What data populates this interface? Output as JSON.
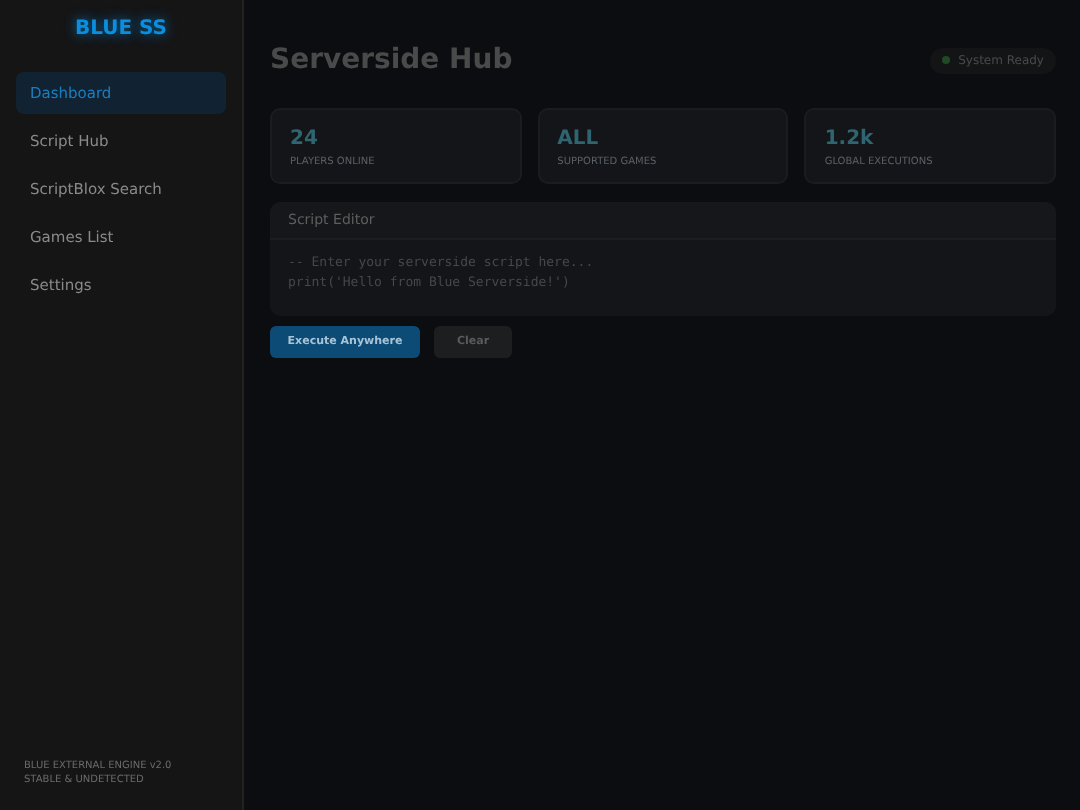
{
  "sidebar": {
    "logo": "BLUE SS",
    "items": [
      {
        "label": "Dashboard",
        "selected": true
      },
      {
        "label": "Script Hub",
        "selected": false
      },
      {
        "label": "ScriptBlox Search",
        "selected": false
      },
      {
        "label": "Games List",
        "selected": false
      },
      {
        "label": "Settings",
        "selected": false
      }
    ],
    "footer": [
      "BLUE EXTERNAL ENGINE v2.0",
      "STABLE & UNDETECTED"
    ]
  },
  "header": {
    "title": "Serverside Hub",
    "status": "System Ready"
  },
  "stats": [
    {
      "value": "24",
      "label": "PLAYERS ONLINE"
    },
    {
      "value": "ALL",
      "label": "SUPPORTED GAMES"
    },
    {
      "value": "1.2k",
      "label": "GLOBAL EXECUTIONS"
    }
  ],
  "editor": {
    "title": "Script Editor",
    "value": "-- Enter your serverside script here...\nprint('Hello from Blue Serverside!')"
  },
  "buttons": [
    {
      "label": "Execute Anywhere",
      "kind": "primary"
    },
    {
      "label": "Clear",
      "kind": "secondary"
    }
  ]
}
